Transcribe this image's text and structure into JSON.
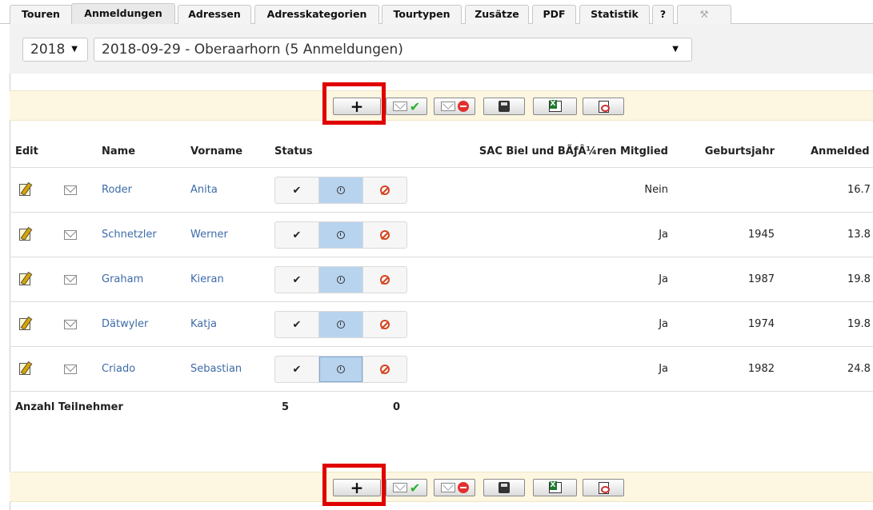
{
  "tabs": [
    {
      "label": "Touren"
    },
    {
      "label": "Anmeldungen",
      "active": true
    },
    {
      "label": "Adressen"
    },
    {
      "label": "Adresskategorien"
    },
    {
      "label": "Tourtypen"
    },
    {
      "label": "Zusätze"
    },
    {
      "label": "PDF"
    },
    {
      "label": "Statistik"
    },
    {
      "label": "?"
    },
    {
      "label": "",
      "icon": "wrench-icon"
    }
  ],
  "selectors": {
    "year": "2018",
    "tour": "2018-09-29 - Oberaarhorn (5 Anmeldungen)"
  },
  "toolbar": {
    "buttons": [
      {
        "name": "add-button",
        "icon": "plus-icon",
        "label": "+"
      },
      {
        "name": "mail-confirmed-button",
        "icon": "mail-check-icon"
      },
      {
        "name": "mail-rejected-button",
        "icon": "mail-stop-icon"
      },
      {
        "name": "save-button",
        "icon": "floppy-icon"
      },
      {
        "name": "export-excel-button",
        "icon": "excel-icon"
      },
      {
        "name": "export-pdf-button",
        "icon": "pdf-icon"
      }
    ],
    "highlight_color": "#e00000"
  },
  "table": {
    "headers": {
      "edit": "Edit",
      "name": "Name",
      "vorname": "Vorname",
      "status": "Status",
      "member": "SAC Biel und BÃƒÂ¼ren Mitglied",
      "birth": "Geburtsjahr",
      "anmelde": "Anmelded"
    },
    "rows": [
      {
        "name": "Roder",
        "vorname": "Anita",
        "member": "Nein",
        "birth": "",
        "anmelde": "16.7"
      },
      {
        "name": "Schnetzler",
        "vorname": "Werner",
        "member": "Ja",
        "birth": "1945",
        "anmelde": "13.8"
      },
      {
        "name": "Graham",
        "vorname": "Kieran",
        "member": "Ja",
        "birth": "1987",
        "anmelde": "19.8"
      },
      {
        "name": "Dätwyler",
        "vorname": "Katja",
        "member": "Ja",
        "birth": "1974",
        "anmelde": "19.8"
      },
      {
        "name": "Criado",
        "vorname": "Sebastian",
        "member": "Ja",
        "birth": "1982",
        "anmelde": "24.8"
      }
    ],
    "status_selected": "pending",
    "footer": {
      "label": "Anzahl Teilnehmer",
      "count_confirmed": "5",
      "count_rejected": "0"
    }
  },
  "colors": {
    "link": "#3d6ba8",
    "toolbar_bg": "#fdf6e0",
    "status_active": "#b8d3ee",
    "reject_icon": "#d2451e",
    "confirm_icon": "#2bb12b"
  }
}
